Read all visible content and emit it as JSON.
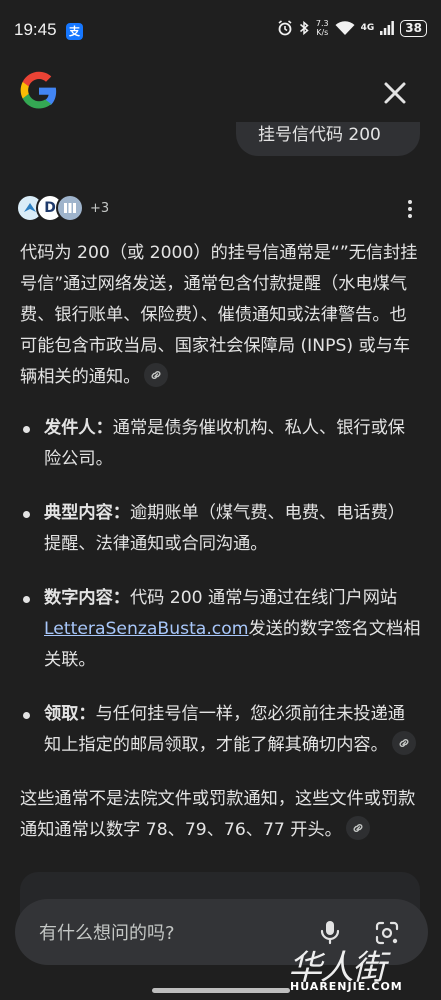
{
  "status_bar": {
    "time": "19:45",
    "app_icon": "支",
    "net_speed_value": "7.3",
    "net_speed_unit": "K/s",
    "signal": "4G",
    "battery": "38"
  },
  "header": {
    "logo": "google-logo",
    "close_icon": "close-icon"
  },
  "user_query": {
    "text": "挂号信代码 200"
  },
  "sources": {
    "extra_count": "+3",
    "more_icon": "more-vert-icon"
  },
  "answer": {
    "intro": "代码为 200（或 2000）的挂号信通常是“”无信封挂号信”通过网络发送，通常包含付款提醒（水电煤气费、银行账单、保险费）、催债通知或法律警告。也可能包含市政当局、国家社会保障局 (INPS) 或与车辆相关的通知。",
    "bullets": [
      {
        "title": "发件人：",
        "text": "通常是债务催收机构、私人、银行或保险公司。"
      },
      {
        "title": "典型内容：",
        "text": "逾期账单（煤气费、电费、电话费）提醒、法律通知或合同沟通。"
      },
      {
        "title": "数字内容：",
        "text_before": "代码 200 通常与通过在线门户网站",
        "link": "LetteraSenzaBusta.com",
        "text_after": "发送的数字签名文档相关联。"
      },
      {
        "title": "领取：",
        "text": "与任何挂号信一样，您必须前往未投递通知上指定的邮局领取，才能了解其确切内容。"
      }
    ],
    "closing": "这些通常不是法院文件或罚款通知，这些文件或罚款通知通常以数字 78、79、76、77 开头。"
  },
  "input": {
    "placeholder": "有什么想问的吗?"
  },
  "watermark": {
    "text": "华人街",
    "sub": "HUARENJIE.COM"
  }
}
